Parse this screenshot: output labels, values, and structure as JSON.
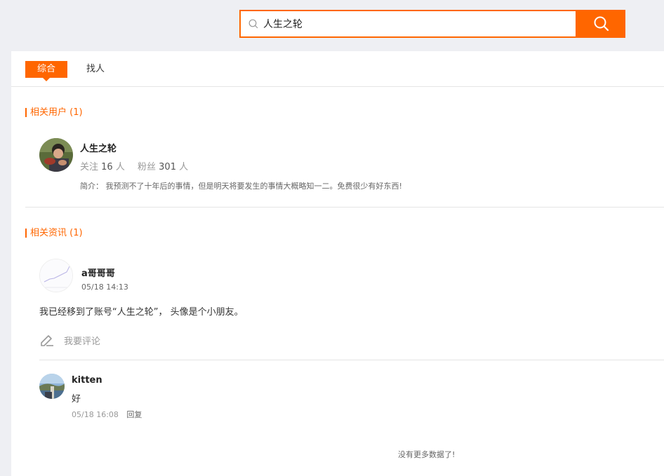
{
  "search": {
    "query": "人生之轮"
  },
  "tabs": [
    {
      "label": "综合",
      "active": true
    },
    {
      "label": "找人",
      "active": false
    }
  ],
  "related_users": {
    "title": "相关用户 (1)",
    "users": [
      {
        "name": "人生之轮",
        "following_label": "关注",
        "following_count": "16",
        "followers_label": "粉丝",
        "followers_count": "301",
        "unit": "人",
        "bio_label": "简介：",
        "bio": "我预测不了十年后的事情，但是明天将要发生的事情大概略知一二。免费很少有好东西!"
      }
    ]
  },
  "related_news": {
    "title": "相关资讯 (1)",
    "items": [
      {
        "author": "a哥哥哥",
        "time": "05/18 14:13",
        "content": "我已经移到了账号“人生之轮”， 头像是个小朋友。",
        "comment_prompt": "我要评论",
        "replies": [
          {
            "author": "kitten",
            "text": "好",
            "time": "05/18 16:08",
            "reply_label": "回复"
          }
        ]
      }
    ]
  },
  "footer": {
    "no_more": "没有更多数据了!"
  },
  "colors": {
    "accent": "#ff6600",
    "background": "#eeeff3"
  }
}
